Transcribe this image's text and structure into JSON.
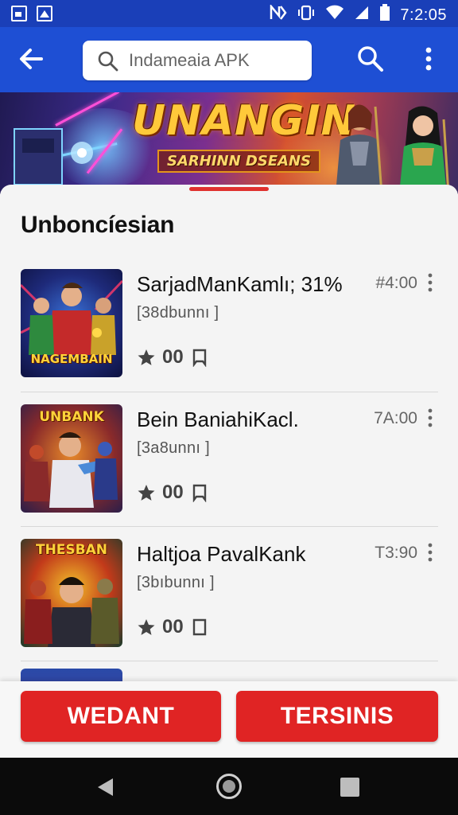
{
  "status_bar": {
    "time": "7:2:05"
  },
  "app_bar": {
    "search": {
      "value": "Indameaia APK",
      "placeholder": ""
    }
  },
  "banner": {
    "title": "UNANGIN",
    "subtitle": "SARHINN DSEANS"
  },
  "section": {
    "title": "Unboncíesian"
  },
  "items": [
    {
      "name": "SarjadManKamlı; 31%",
      "meta": "[38dbunnı ]",
      "count": "00",
      "price": "#4:00",
      "thumb_title": "NAGEMBAIN"
    },
    {
      "name": "Bein BaniahiKacl.",
      "meta": "[3a8unnı ]",
      "count": "00",
      "price": "7A:00",
      "thumb_title": "UNBANK"
    },
    {
      "name": "Haltjoa PavalKank",
      "meta": "[3bıbunnı ]",
      "count": "00",
      "price": "T3:90",
      "thumb_title": "THESBAN"
    }
  ],
  "actions": {
    "primary_label": "WEDANT",
    "secondary_label": "TERSINIS"
  },
  "colors": {
    "status_bar": "#1a3fb8",
    "app_bar": "#1e4fd4",
    "accent_red": "#e02424"
  },
  "icons": [
    "back-arrow-icon",
    "search-icon",
    "more-vert-icon",
    "star-icon",
    "download-icon",
    "bookmark-icon"
  ]
}
